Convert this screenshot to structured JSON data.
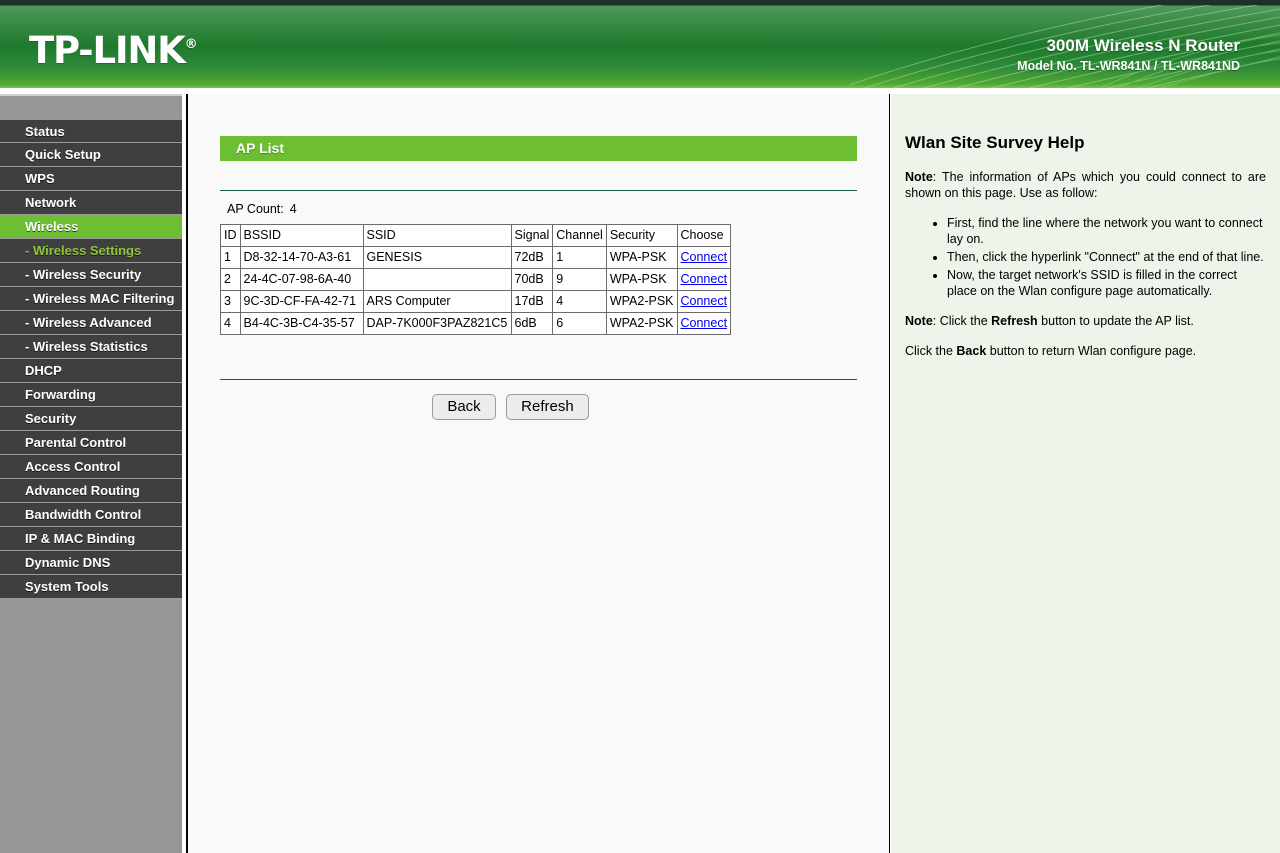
{
  "header": {
    "logo": "TP-LINK",
    "logo_mark": "®",
    "product_title": "300M Wireless N Router",
    "product_model": "Model No. TL-WR841N / TL-WR841ND",
    "accent_green": "#6dbe32",
    "header_green": "#1d7a2d"
  },
  "sidebar": {
    "items": [
      {
        "label": "Status",
        "type": "top",
        "state": "normal"
      },
      {
        "label": "Quick Setup",
        "type": "top",
        "state": "normal"
      },
      {
        "label": "WPS",
        "type": "top",
        "state": "normal"
      },
      {
        "label": "Network",
        "type": "top",
        "state": "normal"
      },
      {
        "label": "Wireless",
        "type": "top",
        "state": "active"
      },
      {
        "label": "- Wireless Settings",
        "type": "sub",
        "state": "current"
      },
      {
        "label": "- Wireless Security",
        "type": "sub",
        "state": "normal"
      },
      {
        "label": "- Wireless MAC Filtering",
        "type": "sub",
        "state": "normal"
      },
      {
        "label": "- Wireless Advanced",
        "type": "sub",
        "state": "normal"
      },
      {
        "label": "- Wireless Statistics",
        "type": "sub",
        "state": "normal"
      },
      {
        "label": "DHCP",
        "type": "top",
        "state": "normal"
      },
      {
        "label": "Forwarding",
        "type": "top",
        "state": "normal"
      },
      {
        "label": "Security",
        "type": "top",
        "state": "normal"
      },
      {
        "label": "Parental Control",
        "type": "top",
        "state": "normal"
      },
      {
        "label": "Access Control",
        "type": "top",
        "state": "normal"
      },
      {
        "label": "Advanced Routing",
        "type": "top",
        "state": "normal"
      },
      {
        "label": "Bandwidth Control",
        "type": "top",
        "state": "normal"
      },
      {
        "label": "IP & MAC Binding",
        "type": "top",
        "state": "normal"
      },
      {
        "label": "Dynamic DNS",
        "type": "top",
        "state": "normal"
      },
      {
        "label": "System Tools",
        "type": "top",
        "state": "normal"
      }
    ]
  },
  "main": {
    "page_title": "AP List",
    "ap_count_label": "AP Count:",
    "ap_count_value": "4",
    "table": {
      "columns": [
        "ID",
        "BSSID",
        "SSID",
        "Signal",
        "Channel",
        "Security",
        "Choose"
      ],
      "rows": [
        {
          "id": "1",
          "bssid": "D8-32-14-70-A3-61",
          "ssid": "GENESIS",
          "signal": "72dB",
          "channel": "1",
          "security": "WPA-PSK",
          "choose": "Connect"
        },
        {
          "id": "2",
          "bssid": "24-4C-07-98-6A-40",
          "ssid": "",
          "signal": "70dB",
          "channel": "9",
          "security": "WPA-PSK",
          "choose": "Connect"
        },
        {
          "id": "3",
          "bssid": "9C-3D-CF-FA-42-71",
          "ssid": "ARS Computer",
          "signal": "17dB",
          "channel": "4",
          "security": "WPA2-PSK",
          "choose": "Connect"
        },
        {
          "id": "4",
          "bssid": "B4-4C-3B-C4-35-57",
          "ssid": "DAP-7K000F3PAZ821C5",
          "signal": "6dB",
          "channel": "6",
          "security": "WPA2-PSK",
          "choose": "Connect"
        }
      ]
    },
    "buttons": {
      "back": "Back",
      "refresh": "Refresh"
    }
  },
  "help": {
    "title": "Wlan Site Survey Help",
    "note_label_1": "Note",
    "note_1": ": The information of APs which you could connect to are shown on this page. Use as follow:",
    "bullets": [
      "First, find the line where the network you want to connect lay on.",
      "Then, click the hyperlink \"Connect\" at the end of that line.",
      "Now, the target network's SSID is filled in the correct place on the Wlan configure page automatically."
    ],
    "note_label_2": "Note",
    "note_2_pre": ": Click the ",
    "note_2_strong": "Refresh",
    "note_2_post": " button to update the AP list.",
    "back_note_pre": "Click the ",
    "back_note_strong": "Back",
    "back_note_post": " button to return Wlan configure page."
  }
}
